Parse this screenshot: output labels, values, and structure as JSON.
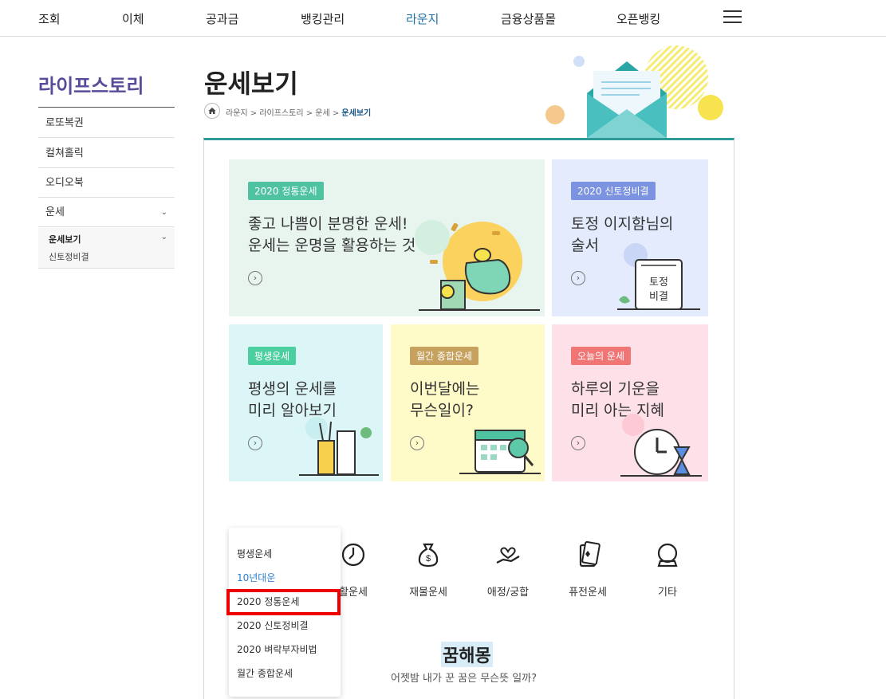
{
  "nav": {
    "items": [
      "조회",
      "이체",
      "공과금",
      "뱅킹관리",
      "라운지",
      "금융상품몰",
      "오픈뱅킹"
    ],
    "active": "라운지"
  },
  "sidebar": {
    "title": "라이프스토리",
    "items": [
      {
        "label": "로또복권"
      },
      {
        "label": "컬쳐홀릭"
      },
      {
        "label": "오디오북"
      },
      {
        "label": "운세"
      }
    ],
    "sub": [
      "운세보기",
      "신토정비결"
    ]
  },
  "header": {
    "title": "운세보기",
    "breadcrumb": "라운지 > 라이프스토리 > 운세 > ",
    "breadcrumb_current": "운세보기"
  },
  "tiles": [
    {
      "badge": "2020 정통운세",
      "line1": "좋고 나쁨이 분명한 운세!",
      "line2": "운세는 운명을 활용하는 것",
      "color": "#e8f5ef",
      "badge_color": "#4fc3a1"
    },
    {
      "badge": "2020 신토정비결",
      "line1": "토정 이지함님의",
      "line2": "술서",
      "color": "#e3ebfd",
      "badge_color": "#7b93e0",
      "art_text": [
        "토정",
        "비결"
      ]
    },
    {
      "badge": "평생운세",
      "line1": "평생의 운세를",
      "line2": "미리 알아보기",
      "color": "#dcf6f7",
      "badge_color": "#4ccfa0"
    },
    {
      "badge": "월간 종합운세",
      "line1": "이번달에는",
      "line2": "무슨일이?",
      "color": "#fefbc8",
      "badge_color": "#c7a25e"
    },
    {
      "badge": "오늘의 운세",
      "line1": "하루의 기운을",
      "line2": "미리 아는 지혜",
      "color": "#fde0e8",
      "badge_color": "#f07575"
    }
  ],
  "categories": [
    {
      "label": "활운세",
      "icon": "clock-icon"
    },
    {
      "label": "재물운세",
      "icon": "money-bag-icon"
    },
    {
      "label": "애정/궁합",
      "icon": "heart-hand-icon"
    },
    {
      "label": "퓨전운세",
      "icon": "cards-icon"
    },
    {
      "label": "기타",
      "icon": "crystal-ball-icon"
    }
  ],
  "dream": {
    "title": "꿈해몽",
    "subtitle": "어젯밤 내가 꾼 꿈은 무슨뜻 일까?"
  },
  "dropdown": {
    "options": [
      "평생운세",
      "10년대운",
      "2020 정통운세",
      "2020 신토정비결",
      "2020 벼락부자비법",
      "월간 종합운세"
    ],
    "highlighted": "10년대운",
    "marked": "2020 정통운세"
  },
  "colors": {
    "accent": "#2e9b98",
    "nav_active": "#1d6fa5",
    "sidebar_title": "#5a4a9a",
    "marker": "#ee0000"
  }
}
